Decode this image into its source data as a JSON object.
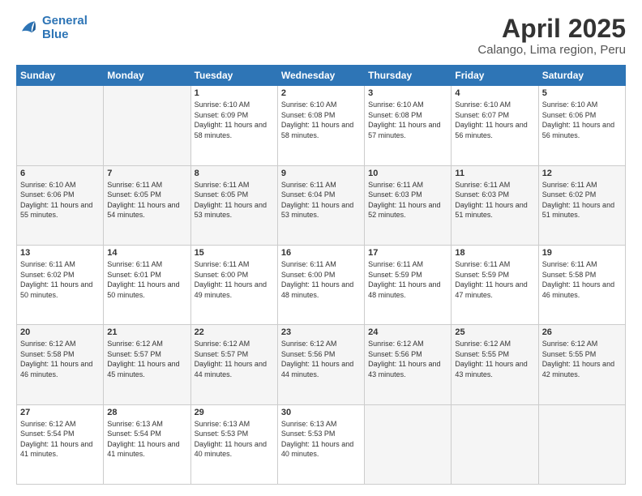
{
  "header": {
    "logo_line1": "General",
    "logo_line2": "Blue",
    "title": "April 2025",
    "subtitle": "Calango, Lima region, Peru"
  },
  "weekdays": [
    "Sunday",
    "Monday",
    "Tuesday",
    "Wednesday",
    "Thursday",
    "Friday",
    "Saturday"
  ],
  "weeks": [
    [
      {
        "day": "",
        "info": ""
      },
      {
        "day": "",
        "info": ""
      },
      {
        "day": "1",
        "info": "Sunrise: 6:10 AM\nSunset: 6:09 PM\nDaylight: 11 hours and 58 minutes."
      },
      {
        "day": "2",
        "info": "Sunrise: 6:10 AM\nSunset: 6:08 PM\nDaylight: 11 hours and 58 minutes."
      },
      {
        "day": "3",
        "info": "Sunrise: 6:10 AM\nSunset: 6:08 PM\nDaylight: 11 hours and 57 minutes."
      },
      {
        "day": "4",
        "info": "Sunrise: 6:10 AM\nSunset: 6:07 PM\nDaylight: 11 hours and 56 minutes."
      },
      {
        "day": "5",
        "info": "Sunrise: 6:10 AM\nSunset: 6:06 PM\nDaylight: 11 hours and 56 minutes."
      }
    ],
    [
      {
        "day": "6",
        "info": "Sunrise: 6:10 AM\nSunset: 6:06 PM\nDaylight: 11 hours and 55 minutes."
      },
      {
        "day": "7",
        "info": "Sunrise: 6:11 AM\nSunset: 6:05 PM\nDaylight: 11 hours and 54 minutes."
      },
      {
        "day": "8",
        "info": "Sunrise: 6:11 AM\nSunset: 6:05 PM\nDaylight: 11 hours and 53 minutes."
      },
      {
        "day": "9",
        "info": "Sunrise: 6:11 AM\nSunset: 6:04 PM\nDaylight: 11 hours and 53 minutes."
      },
      {
        "day": "10",
        "info": "Sunrise: 6:11 AM\nSunset: 6:03 PM\nDaylight: 11 hours and 52 minutes."
      },
      {
        "day": "11",
        "info": "Sunrise: 6:11 AM\nSunset: 6:03 PM\nDaylight: 11 hours and 51 minutes."
      },
      {
        "day": "12",
        "info": "Sunrise: 6:11 AM\nSunset: 6:02 PM\nDaylight: 11 hours and 51 minutes."
      }
    ],
    [
      {
        "day": "13",
        "info": "Sunrise: 6:11 AM\nSunset: 6:02 PM\nDaylight: 11 hours and 50 minutes."
      },
      {
        "day": "14",
        "info": "Sunrise: 6:11 AM\nSunset: 6:01 PM\nDaylight: 11 hours and 50 minutes."
      },
      {
        "day": "15",
        "info": "Sunrise: 6:11 AM\nSunset: 6:00 PM\nDaylight: 11 hours and 49 minutes."
      },
      {
        "day": "16",
        "info": "Sunrise: 6:11 AM\nSunset: 6:00 PM\nDaylight: 11 hours and 48 minutes."
      },
      {
        "day": "17",
        "info": "Sunrise: 6:11 AM\nSunset: 5:59 PM\nDaylight: 11 hours and 48 minutes."
      },
      {
        "day": "18",
        "info": "Sunrise: 6:11 AM\nSunset: 5:59 PM\nDaylight: 11 hours and 47 minutes."
      },
      {
        "day": "19",
        "info": "Sunrise: 6:11 AM\nSunset: 5:58 PM\nDaylight: 11 hours and 46 minutes."
      }
    ],
    [
      {
        "day": "20",
        "info": "Sunrise: 6:12 AM\nSunset: 5:58 PM\nDaylight: 11 hours and 46 minutes."
      },
      {
        "day": "21",
        "info": "Sunrise: 6:12 AM\nSunset: 5:57 PM\nDaylight: 11 hours and 45 minutes."
      },
      {
        "day": "22",
        "info": "Sunrise: 6:12 AM\nSunset: 5:57 PM\nDaylight: 11 hours and 44 minutes."
      },
      {
        "day": "23",
        "info": "Sunrise: 6:12 AM\nSunset: 5:56 PM\nDaylight: 11 hours and 44 minutes."
      },
      {
        "day": "24",
        "info": "Sunrise: 6:12 AM\nSunset: 5:56 PM\nDaylight: 11 hours and 43 minutes."
      },
      {
        "day": "25",
        "info": "Sunrise: 6:12 AM\nSunset: 5:55 PM\nDaylight: 11 hours and 43 minutes."
      },
      {
        "day": "26",
        "info": "Sunrise: 6:12 AM\nSunset: 5:55 PM\nDaylight: 11 hours and 42 minutes."
      }
    ],
    [
      {
        "day": "27",
        "info": "Sunrise: 6:12 AM\nSunset: 5:54 PM\nDaylight: 11 hours and 41 minutes."
      },
      {
        "day": "28",
        "info": "Sunrise: 6:13 AM\nSunset: 5:54 PM\nDaylight: 11 hours and 41 minutes."
      },
      {
        "day": "29",
        "info": "Sunrise: 6:13 AM\nSunset: 5:53 PM\nDaylight: 11 hours and 40 minutes."
      },
      {
        "day": "30",
        "info": "Sunrise: 6:13 AM\nSunset: 5:53 PM\nDaylight: 11 hours and 40 minutes."
      },
      {
        "day": "",
        "info": ""
      },
      {
        "day": "",
        "info": ""
      },
      {
        "day": "",
        "info": ""
      }
    ]
  ]
}
